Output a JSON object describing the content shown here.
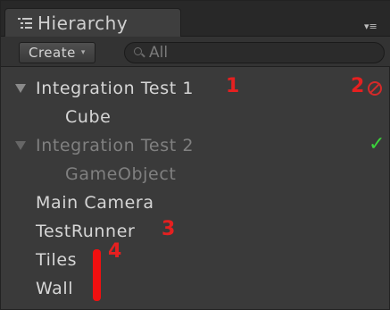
{
  "tab": {
    "title": "Hierarchy",
    "icon": "hierarchy-list-icon"
  },
  "toolbar": {
    "create_label": "Create",
    "create_caret": "▾",
    "search_placeholder": "All",
    "search_icon": "search-icon",
    "menu_glyph": "▾≡"
  },
  "rows": [
    {
      "label": "Integration Test 1",
      "level": 0,
      "foldout": true,
      "disabled": false
    },
    {
      "label": "Cube",
      "level": 1,
      "foldout": false,
      "disabled": false
    },
    {
      "label": "Integration Test 2",
      "level": 0,
      "foldout": true,
      "disabled": true
    },
    {
      "label": "GameObject",
      "level": 1,
      "foldout": false,
      "disabled": true
    },
    {
      "label": "Main Camera",
      "level": 0,
      "foldout": false,
      "disabled": false
    },
    {
      "label": "TestRunner",
      "level": 0,
      "foldout": false,
      "disabled": false
    },
    {
      "label": "Tiles",
      "level": 0,
      "foldout": false,
      "disabled": false
    },
    {
      "label": "Wall",
      "level": 0,
      "foldout": false,
      "disabled": false
    }
  ],
  "annotations": {
    "a1": "1",
    "a2": "2",
    "a3": "3",
    "a4": "4"
  },
  "status": {
    "test1": "error-icon",
    "test2": "check-icon",
    "check_glyph": "✓"
  },
  "colors": {
    "annotation_red": "#e52020",
    "success_green": "#3bd43b",
    "error_red": "#d42a2a"
  }
}
